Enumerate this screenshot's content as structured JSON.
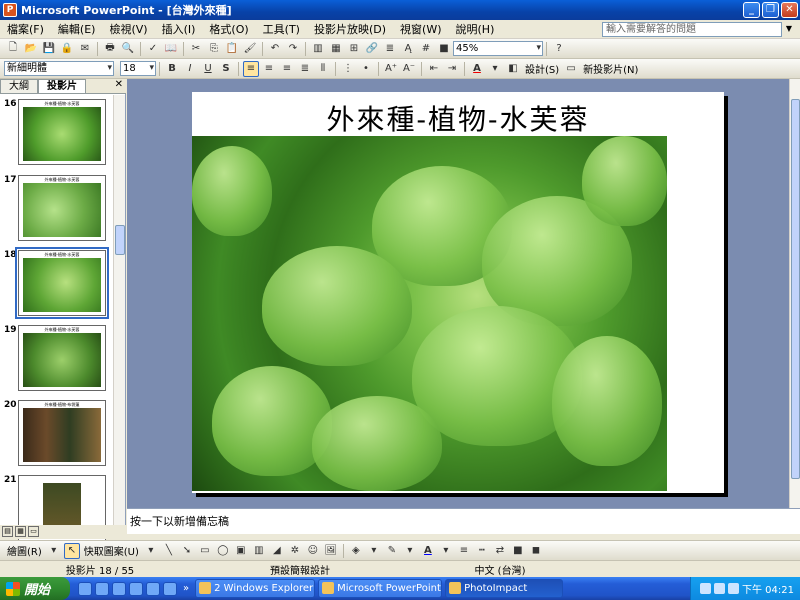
{
  "window": {
    "title": "Microsoft PowerPoint - [台灣外來種]",
    "app_icon_letter": "P"
  },
  "menu": {
    "items": [
      "檔案(F)",
      "編輯(E)",
      "檢視(V)",
      "插入(I)",
      "格式(O)",
      "工具(T)",
      "投影片放映(D)",
      "視窗(W)",
      "說明(H)"
    ],
    "help_placeholder": "輸入需要解答的問題"
  },
  "toolbar": {
    "zoom": "45%"
  },
  "format_toolbar": {
    "font": "新細明體",
    "size": "18",
    "bold": "B",
    "italic": "I",
    "underline": "U",
    "shadow": "S",
    "design_label": "設計(S)",
    "new_slide_label": "新投影片(N)"
  },
  "left_pane": {
    "tabs": [
      "大綱",
      "投影片"
    ],
    "slides": [
      {
        "number": "16",
        "title": "外來種-植物-水芙蓉"
      },
      {
        "number": "17",
        "title": "外來種-植物-水芙蓉"
      },
      {
        "number": "18",
        "title": "外來種-植物-水芙蓉"
      },
      {
        "number": "19",
        "title": "外來種-植物-水芙蓉"
      },
      {
        "number": "20",
        "title": "外來種-植物-布袋蓮"
      },
      {
        "number": "21",
        "title": ""
      }
    ]
  },
  "slide": {
    "title": "外來種-植物-水芙蓉"
  },
  "notes": {
    "placeholder": "按一下以新增備忘稿"
  },
  "draw_toolbar": {
    "draw_label": "繪圖(R)",
    "autoshapes_label": "快取圖案(U)"
  },
  "status": {
    "slide_pos": "投影片 18 / 55",
    "design": "預設簡報設計",
    "language": "中文 (台灣)"
  },
  "taskbar": {
    "start_label": "開始",
    "tasks": [
      {
        "label": "2 Windows Explorer"
      },
      {
        "label": "Microsoft PowerPoint ..."
      },
      {
        "label": "PhotoImpact"
      }
    ],
    "clock": "下午 04:21"
  }
}
